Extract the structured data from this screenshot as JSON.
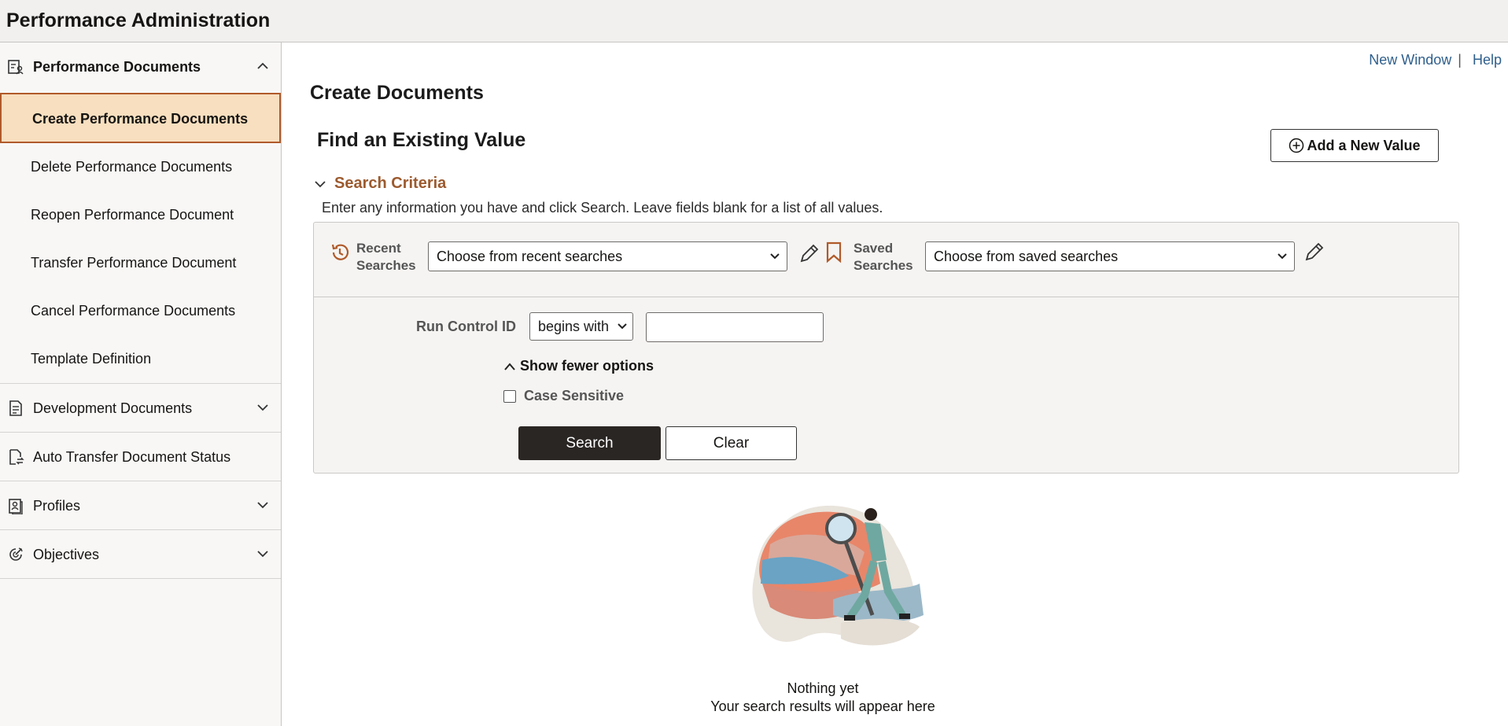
{
  "app": {
    "title": "Performance Administration"
  },
  "sidebar": {
    "groups": [
      {
        "label": "Performance Documents",
        "icon": "performance-documents-icon",
        "expanded": true,
        "items": [
          {
            "label": "Create Performance Documents",
            "active": true
          },
          {
            "label": "Delete Performance Documents"
          },
          {
            "label": "Reopen Performance Document"
          },
          {
            "label": "Transfer Performance Document"
          },
          {
            "label": "Cancel Performance Documents"
          },
          {
            "label": "Template Definition"
          }
        ]
      },
      {
        "label": "Development Documents",
        "icon": "document-icon",
        "expanded": false
      },
      {
        "label": "Auto Transfer Document Status",
        "icon": "transfer-document-icon"
      },
      {
        "label": "Profiles",
        "icon": "profiles-icon",
        "expanded": false
      },
      {
        "label": "Objectives",
        "icon": "objectives-icon",
        "expanded": false
      }
    ]
  },
  "header_links": {
    "new_window": "New Window",
    "separator": "|",
    "help": "Help"
  },
  "page": {
    "title": "Create Documents",
    "find_heading": "Find an Existing Value",
    "add_button": "Add a New Value",
    "criteria_label": "Search Criteria",
    "instructions": "Enter any information you have and click Search. Leave fields blank for a list of all values."
  },
  "search": {
    "recent_label_1": "Recent",
    "recent_label_2": "Searches",
    "recent_value": "Choose from recent searches",
    "saved_label_1": "Saved",
    "saved_label_2": "Searches",
    "saved_value": "Choose from saved searches",
    "run_control_label": "Run Control ID",
    "operator_value": "begins with",
    "run_control_value": "",
    "fewer_options": "Show fewer options",
    "case_sensitive": "Case Sensitive",
    "case_checked": false,
    "search_button": "Search",
    "clear_button": "Clear"
  },
  "empty_state": {
    "title": "Nothing yet",
    "subtitle": "Your search results will appear here"
  },
  "colors": {
    "accent": "#9c5a2e",
    "active_bg": "#f8dfbf",
    "link": "#2f5f8c",
    "primary_button": "#2a2624"
  }
}
